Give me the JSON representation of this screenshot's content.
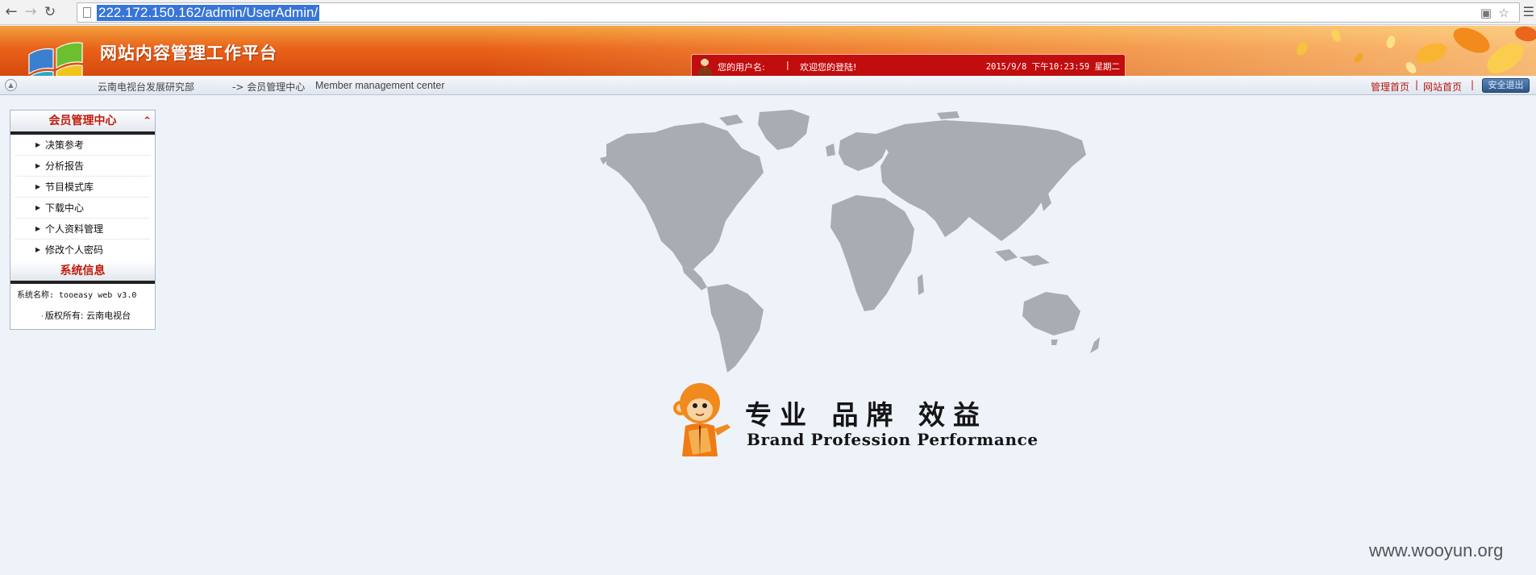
{
  "browser": {
    "url": "222.172.150.162/admin/UserAdmin/",
    "back_icon": "back-arrow-icon",
    "forward_icon": "forward-arrow-icon",
    "reload_icon": "reload-icon"
  },
  "header": {
    "site_title": "网站内容管理工作平台",
    "user_label": "您的用户名:",
    "separator": "|",
    "welcome": "欢迎您的登陆!",
    "datetime": "2015/9/8 下午10:23:59 星期二"
  },
  "subbar": {
    "department": "云南电视台发展研究部",
    "breadcrumb_cn": "-> 会员管理中心",
    "breadcrumb_en": "Member management center",
    "links": [
      "管理首页",
      "网站首页"
    ],
    "link_separator": "|",
    "logout": "安全退出"
  },
  "sidebar": {
    "title": "会员管理中心",
    "items": [
      {
        "label": "决策参考"
      },
      {
        "label": "分析报告"
      },
      {
        "label": "节目模式库"
      },
      {
        "label": "下载中心"
      },
      {
        "label": "个人资料管理"
      },
      {
        "label": "修改个人密码"
      }
    ],
    "system_title": "系统信息",
    "system_name": "系统名称: tooeasy web v3.0",
    "copyright": "版权所有:  云南电视台"
  },
  "branding": {
    "slogan_cn": "专业 品牌 效益",
    "slogan_en": "Brand Profession Performance"
  },
  "watermark": "www.wooyun.org",
  "colors": {
    "banner_orange": "#e9621a",
    "user_bar_red": "#c10d0d",
    "link_red": "#b4170d",
    "page_background": "#eef3fa",
    "map_gray": "#a9adb3"
  }
}
